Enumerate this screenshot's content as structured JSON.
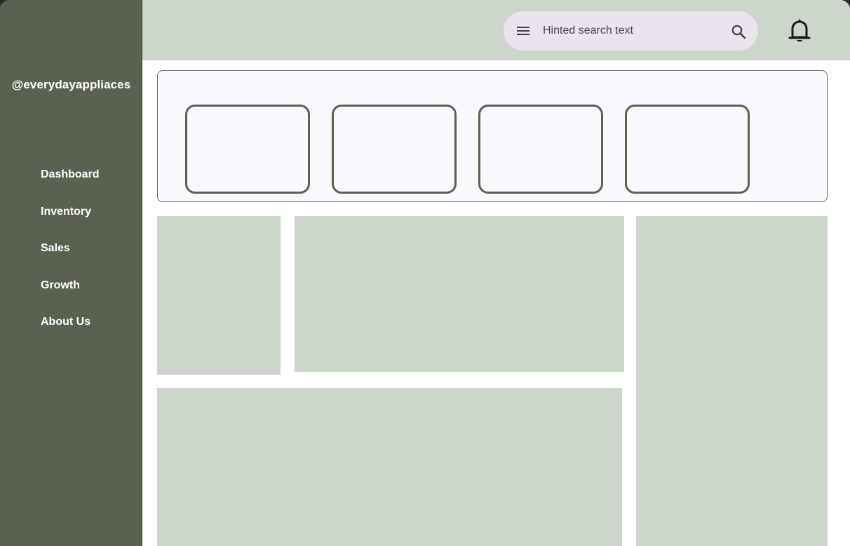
{
  "brand": {
    "handle": "@everydayappliaces"
  },
  "sidebar": {
    "items": [
      {
        "label": "Dashboard"
      },
      {
        "label": "Inventory"
      },
      {
        "label": "Sales"
      },
      {
        "label": "Growth"
      },
      {
        "label": "About Us"
      }
    ]
  },
  "topbar": {
    "search": {
      "placeholder": "Hinted search text",
      "value": ""
    },
    "icons": [
      "menu-icon",
      "search-icon",
      "bell-icon"
    ]
  },
  "stats": {
    "card_count": 4
  },
  "colors": {
    "sidebar": "#5a6150",
    "topbar": "#ccd6ca",
    "search_bar": "#ebe3ee",
    "panel": "#f7f9fd",
    "card_border": "#5c6150",
    "placeholder_block": "#ccd6ca"
  }
}
